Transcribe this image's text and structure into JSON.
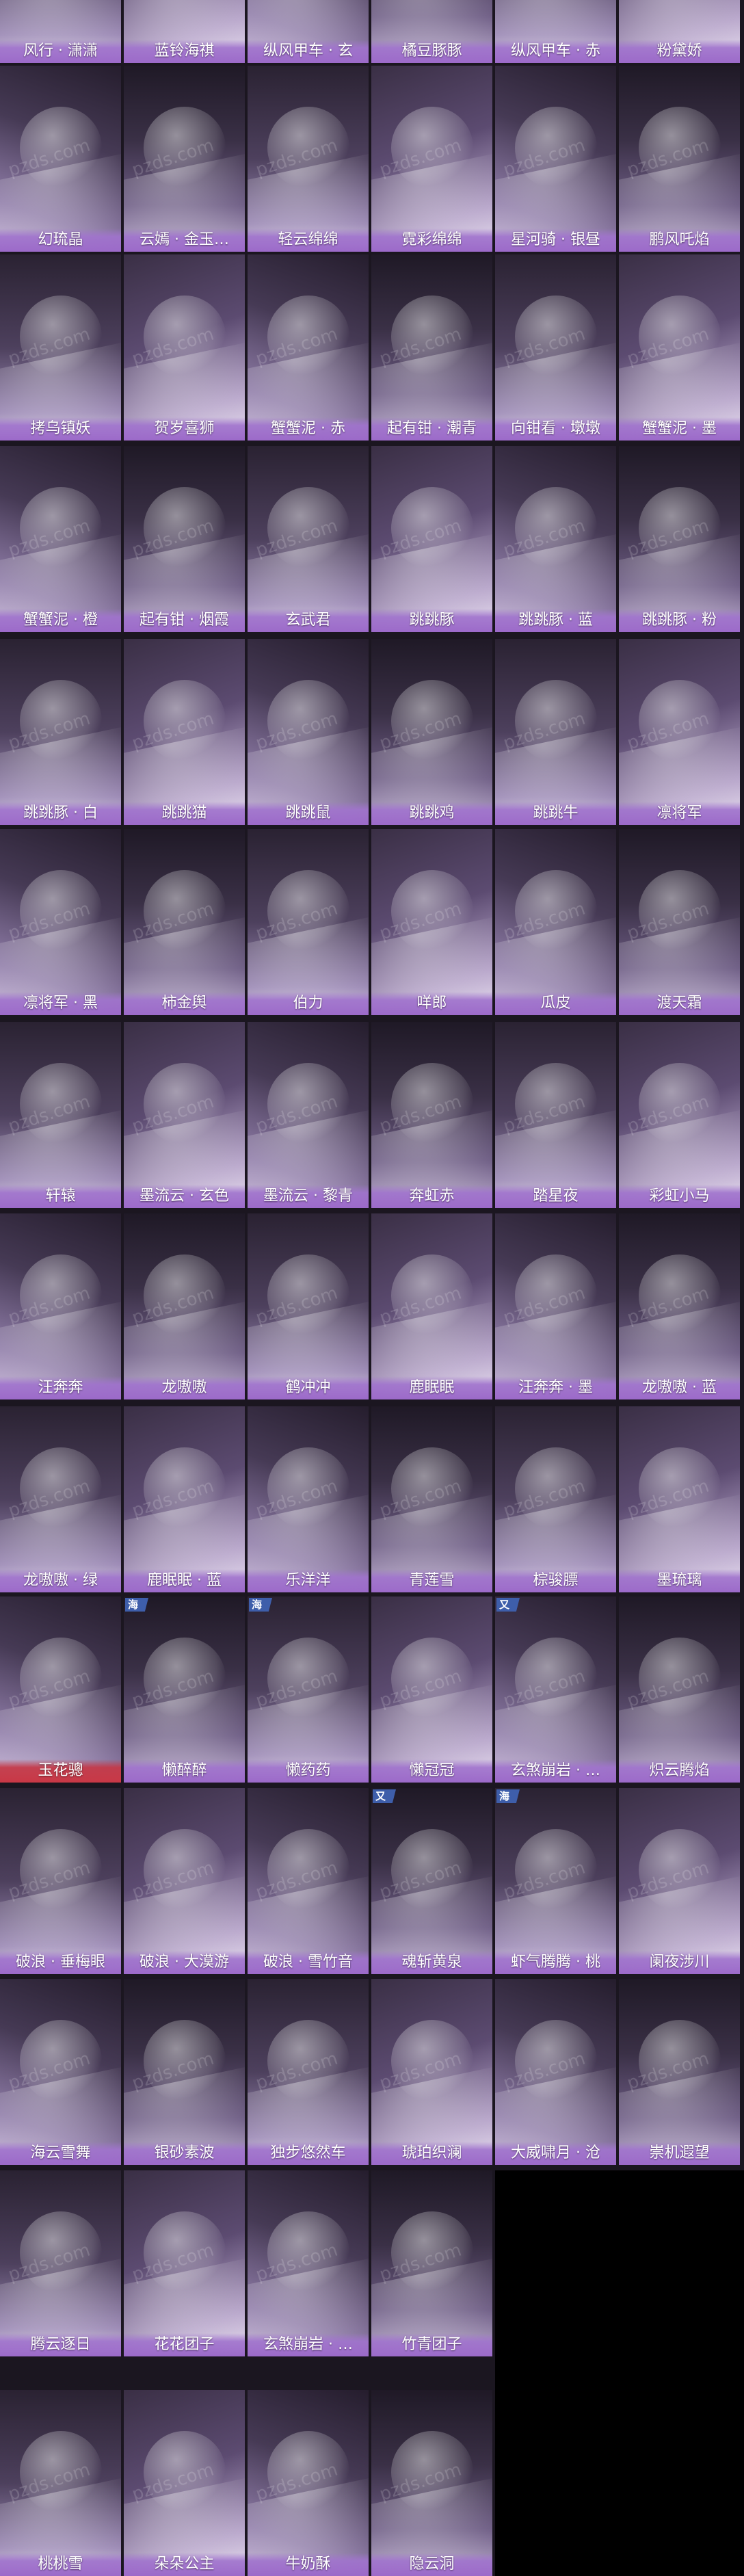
{
  "watermark": "pzds.com",
  "items": [
    {
      "name": "风行 · 潇潇",
      "badge": ""
    },
    {
      "name": "蓝铃海祺",
      "badge": ""
    },
    {
      "name": "纵风甲车 · 玄",
      "badge": ""
    },
    {
      "name": "橘豆豚豚",
      "badge": ""
    },
    {
      "name": "纵风甲车 · 赤",
      "badge": ""
    },
    {
      "name": "粉黛娇",
      "badge": ""
    },
    {
      "name": "幻琉晶",
      "badge": ""
    },
    {
      "name": "云嫣 · 金玉…",
      "badge": ""
    },
    {
      "name": "轻云绵绵",
      "badge": ""
    },
    {
      "name": "霓彩绵绵",
      "badge": ""
    },
    {
      "name": "星河骑 · 银昼",
      "badge": ""
    },
    {
      "name": "鹏风吒焰",
      "badge": ""
    },
    {
      "name": "拷乌镇妖",
      "badge": ""
    },
    {
      "name": "贺岁喜狮",
      "badge": ""
    },
    {
      "name": "蟹蟹泥 · 赤",
      "badge": ""
    },
    {
      "name": "起有钳 · 潮青",
      "badge": ""
    },
    {
      "name": "向钳看 · 墩墩",
      "badge": ""
    },
    {
      "name": "蟹蟹泥 · 墨",
      "badge": ""
    },
    {
      "name": "蟹蟹泥 · 橙",
      "badge": ""
    },
    {
      "name": "起有钳 · 烟霞",
      "badge": ""
    },
    {
      "name": "玄武君",
      "badge": ""
    },
    {
      "name": "跳跳豚",
      "badge": ""
    },
    {
      "name": "跳跳豚 · 蓝",
      "badge": ""
    },
    {
      "name": "跳跳豚 · 粉",
      "badge": ""
    },
    {
      "name": "跳跳豚 · 白",
      "badge": ""
    },
    {
      "name": "跳跳猫",
      "badge": ""
    },
    {
      "name": "跳跳鼠",
      "badge": ""
    },
    {
      "name": "跳跳鸡",
      "badge": ""
    },
    {
      "name": "跳跳牛",
      "badge": ""
    },
    {
      "name": "凛将军",
      "badge": ""
    },
    {
      "name": "凛将军 · 黑",
      "badge": ""
    },
    {
      "name": "柿金舆",
      "badge": ""
    },
    {
      "name": "伯力",
      "badge": ""
    },
    {
      "name": "咩郎",
      "badge": ""
    },
    {
      "name": "瓜皮",
      "badge": ""
    },
    {
      "name": "渡天霜",
      "badge": ""
    },
    {
      "name": "轩辕",
      "badge": ""
    },
    {
      "name": "墨流云 · 玄色",
      "badge": ""
    },
    {
      "name": "墨流云 · 黎青",
      "badge": ""
    },
    {
      "name": "奔虹赤",
      "badge": ""
    },
    {
      "name": "踏星夜",
      "badge": ""
    },
    {
      "name": "彩虹小马",
      "badge": ""
    },
    {
      "name": "汪奔奔",
      "badge": ""
    },
    {
      "name": "龙嗷嗷",
      "badge": ""
    },
    {
      "name": "鹤冲冲",
      "badge": ""
    },
    {
      "name": "鹿眠眠",
      "badge": ""
    },
    {
      "name": "汪奔奔 · 墨",
      "badge": ""
    },
    {
      "name": "龙嗷嗷 · 蓝",
      "badge": ""
    },
    {
      "name": "龙嗷嗷 · 绿",
      "badge": ""
    },
    {
      "name": "鹿眠眠 · 蓝",
      "badge": ""
    },
    {
      "name": "乐洋洋",
      "badge": ""
    },
    {
      "name": "青莲雪",
      "badge": ""
    },
    {
      "name": "棕骏膘",
      "badge": ""
    },
    {
      "name": "墨琉璃",
      "badge": ""
    },
    {
      "name": "玉花骢",
      "badge": "",
      "red": true
    },
    {
      "name": "懒醉醉",
      "badge": "海"
    },
    {
      "name": "懒药药",
      "badge": "海"
    },
    {
      "name": "懒冠冠",
      "badge": ""
    },
    {
      "name": "玄煞崩岩 · …",
      "badge": "又"
    },
    {
      "name": "炽云腾焰",
      "badge": ""
    },
    {
      "name": "破浪 · 垂梅眼",
      "badge": ""
    },
    {
      "name": "破浪 · 大漠游",
      "badge": ""
    },
    {
      "name": "破浪 · 雪竹音",
      "badge": ""
    },
    {
      "name": "魂斩黄泉",
      "badge": "又"
    },
    {
      "name": "虾气腾腾 · 桃",
      "badge": "海"
    },
    {
      "name": "阑夜涉川",
      "badge": ""
    },
    {
      "name": "海云雪舞",
      "badge": ""
    },
    {
      "name": "银砂素波",
      "badge": ""
    },
    {
      "name": "独步悠然车",
      "badge": ""
    },
    {
      "name": "琥珀织澜",
      "badge": ""
    },
    {
      "name": "大威啸月 · 沧",
      "badge": ""
    },
    {
      "name": "崇机遐望",
      "badge": ""
    },
    {
      "name": "腾云逐日",
      "badge": ""
    },
    {
      "name": "花花团子",
      "badge": ""
    },
    {
      "name": "玄煞崩岩 · …",
      "badge": ""
    },
    {
      "name": "竹青团子",
      "badge": ""
    },
    {
      "name": "桃桃雪",
      "badge": ""
    },
    {
      "name": "朵朵公主",
      "badge": ""
    },
    {
      "name": "牛奶酥",
      "badge": ""
    },
    {
      "name": "隐云洞",
      "badge": ""
    }
  ]
}
